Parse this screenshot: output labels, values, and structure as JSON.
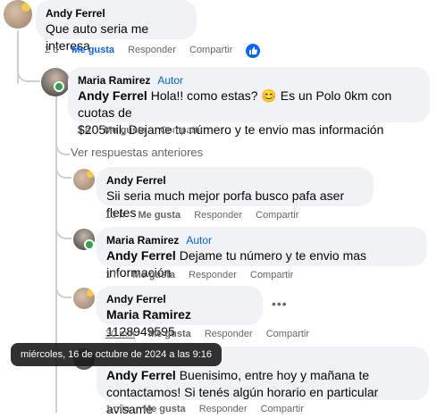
{
  "comments": [
    {
      "author": "Andy Ferrel",
      "text": "Que auto seria me interesa",
      "time": "2 d",
      "like": "Me gusta",
      "reply": "Responder",
      "share": "Compartir"
    },
    {
      "author": "Maria Ramirez",
      "role": "Autor",
      "mention": "Andy Ferrel",
      "text_line1": "Hola!! como estas? 😊 Es un Polo 0km con cuotas de",
      "text_line2": "$205mil. Dejame tu número y te envio mas información",
      "time": "1 d",
      "like": "Me gusta",
      "share": "Compartir"
    },
    {
      "view_previous": "Ver respuestas anteriores"
    },
    {
      "author": "Andy Ferrel",
      "text": "Sii seria much mejor porfa busco pafa aser fletes",
      "time": "13 h",
      "like": "Me gusta",
      "reply": "Responder",
      "share": "Compartir"
    },
    {
      "author": "Maria Ramirez",
      "role": "Autor",
      "mention": "Andy Ferrel",
      "text": "Dejame tu número y te envio mas información",
      "time": "1 h",
      "like": "Me gusta",
      "reply": "Responder",
      "share": "Compartir"
    },
    {
      "author": "Andy Ferrel",
      "mention": "Maria Ramirez",
      "text": "1128949595",
      "time": "30 min",
      "like": "Me gusta",
      "reply": "Responder",
      "share": "Compartir"
    },
    {
      "mention": "Andy Ferrel",
      "text_line1": "Buenisimo, entre hoy y mañana te",
      "text_line2": "contactamos! Si tenés algún horario en particular avisame",
      "time": "1 min",
      "like": "Me gusta",
      "reply": "Responder",
      "share": "Compartir"
    }
  ],
  "tooltip": "miércoles, 16 de octubre de 2024 a las 9:16",
  "colors": {
    "bubble": "#f0f2f5",
    "link_blue": "#0866ff",
    "muted": "#65676b"
  },
  "icons": [
    "like-reaction-icon",
    "more-options-icon"
  ]
}
